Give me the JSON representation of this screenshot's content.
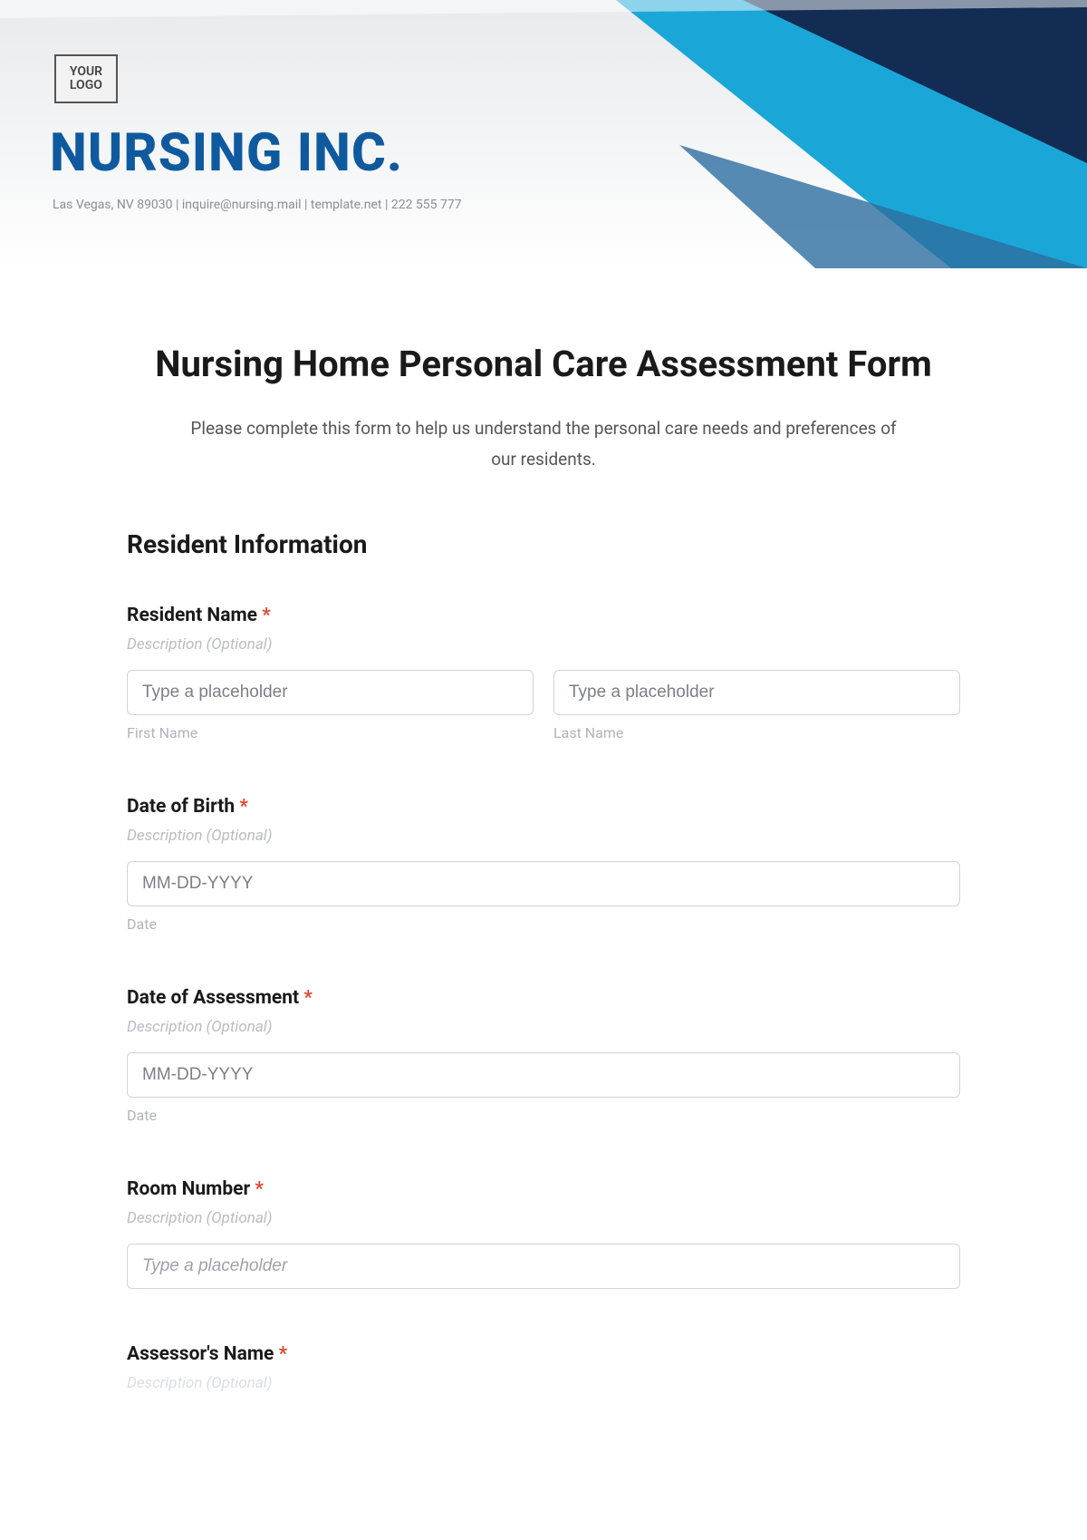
{
  "header": {
    "logo_text": "YOUR\nLOGO",
    "company_name": "NURSING INC.",
    "company_sub": "Las Vegas, NV 89030 | inquire@nursing.mail | template.net | 222 555 777"
  },
  "form": {
    "title": "Nursing Home Personal Care Assessment Form",
    "subtitle": "Please complete this form to help us understand the personal care needs and preferences of our residents.",
    "section_title": "Resident Information",
    "required_mark": "*",
    "desc_placeholder": "Description (Optional)",
    "fields": {
      "resident_name": {
        "label": "Resident Name",
        "first_placeholder": "Type a placeholder",
        "first_sub": "First Name",
        "last_placeholder": "Type a placeholder",
        "last_sub": "Last Name"
      },
      "dob": {
        "label": "Date of Birth",
        "placeholder": "MM-DD-YYYY",
        "sub": "Date"
      },
      "doa": {
        "label": "Date of Assessment",
        "placeholder": "MM-DD-YYYY",
        "sub": "Date"
      },
      "room": {
        "label": "Room Number",
        "placeholder": "Type a placeholder"
      },
      "assessor": {
        "label": "Assessor's Name"
      }
    }
  }
}
